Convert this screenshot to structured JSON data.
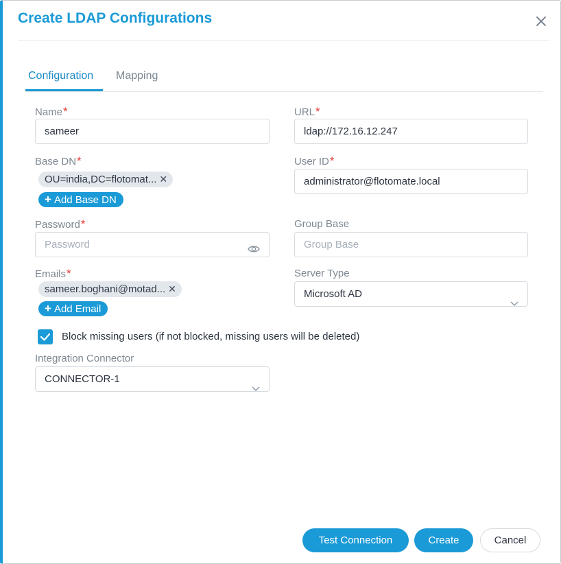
{
  "dialog": {
    "title": "Create LDAP Configurations"
  },
  "tabs": [
    {
      "label": "Configuration",
      "active": true
    },
    {
      "label": "Mapping",
      "active": false
    }
  ],
  "fields": {
    "name": {
      "label": "Name",
      "required": "*",
      "value": "sameer"
    },
    "url": {
      "label": "URL",
      "required": "*",
      "value": "ldap://172.16.12.247"
    },
    "base_dn": {
      "label": "Base DN",
      "required": "*",
      "chip": "OU=india,DC=flotomat...",
      "add_label": "Add Base DN"
    },
    "user_id": {
      "label": "User ID",
      "required": "*",
      "value": "administrator@flotomate.local"
    },
    "password": {
      "label": "Password",
      "required": "*",
      "placeholder": "Password"
    },
    "group_base": {
      "label": "Group Base",
      "placeholder": "Group Base"
    },
    "emails": {
      "label": "Emails",
      "required": "*",
      "chip": "sameer.boghani@motad...",
      "add_label": "Add Email"
    },
    "server_type": {
      "label": "Server Type",
      "value": "Microsoft AD"
    },
    "block_missing": {
      "label": "Block missing users (if not blocked, missing users will be deleted)",
      "checked": true
    },
    "integration_connector": {
      "label": "Integration Connector",
      "value": "CONNECTOR-1"
    }
  },
  "footer": {
    "test_label": "Test Connection",
    "create_label": "Create",
    "cancel_label": "Cancel"
  },
  "colors": {
    "accent": "#1a9ad6",
    "required": "#e53935"
  }
}
